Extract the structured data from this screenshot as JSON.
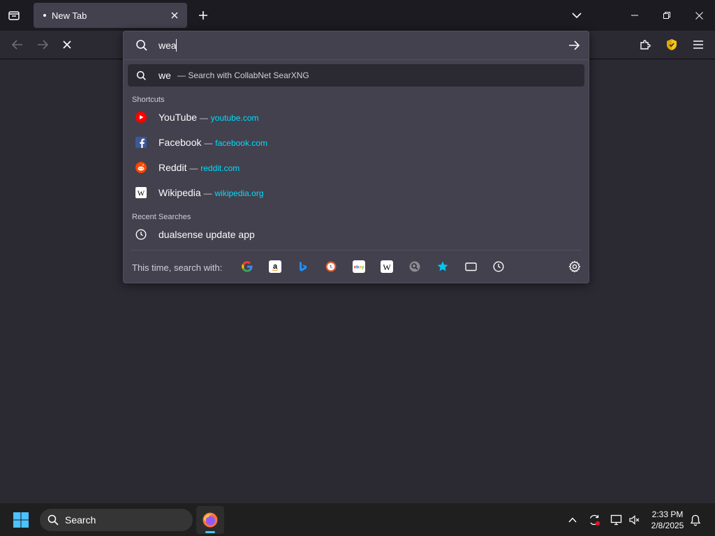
{
  "tab": {
    "title": "New Tab"
  },
  "urlbar": {
    "query": "wea",
    "heuristic": {
      "text": "we",
      "action": "— Search with CollabNet SearXNG"
    },
    "shortcuts_label": "Shortcuts",
    "shortcuts": [
      {
        "title": "YouTube",
        "url": "youtube.com",
        "icon": "youtube-icon"
      },
      {
        "title": "Facebook",
        "url": "facebook.com",
        "icon": "facebook-icon"
      },
      {
        "title": "Reddit",
        "url": "reddit.com",
        "icon": "reddit-icon"
      },
      {
        "title": "Wikipedia",
        "url": "wikipedia.org",
        "icon": "wikipedia-icon"
      }
    ],
    "recent_label": "Recent Searches",
    "recent": [
      {
        "title": "dualsense update app",
        "icon": "history-clock-icon"
      }
    ],
    "oneoff_label": "This time, search with:",
    "engines": [
      "google",
      "amazon",
      "bing",
      "duckduckgo",
      "ebay",
      "wikipedia",
      "searxng",
      "bookmarks",
      "tabs",
      "history"
    ]
  },
  "taskbar": {
    "search_label": "Search",
    "time": "2:33 PM",
    "date": "2/8/2025"
  },
  "colors": {
    "accent_url": "#00ddff",
    "panel": "#42414d",
    "toolbar": "#2b2a33",
    "frame": "#1c1b22"
  }
}
